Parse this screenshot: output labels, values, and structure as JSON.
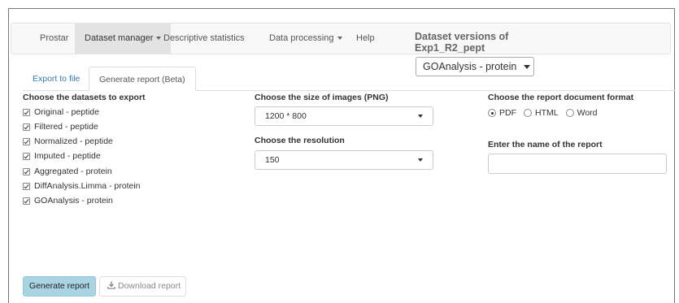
{
  "navbar": {
    "items": [
      {
        "label": "Prostar"
      },
      {
        "label": "Dataset manager"
      },
      {
        "label": "Descriptive statistics"
      },
      {
        "label": "Data processing"
      },
      {
        "label": "Help"
      }
    ]
  },
  "versions": {
    "title_line1": "Dataset versions of",
    "title_line2": "Exp1_R2_pept",
    "selected": "GOAnalysis - protein"
  },
  "tabs": [
    {
      "label": "Export to file"
    },
    {
      "label": "Generate report (Beta)"
    }
  ],
  "datasets": {
    "heading": "Choose the datasets to export",
    "items": [
      {
        "label": "Original - peptide",
        "checked": true
      },
      {
        "label": "Filtered - peptide",
        "checked": true
      },
      {
        "label": "Normalized - peptide",
        "checked": true
      },
      {
        "label": "Imputed - peptide",
        "checked": true
      },
      {
        "label": "Aggregated - protein",
        "checked": true
      },
      {
        "label": "DiffAnalysis.Limma - protein",
        "checked": true
      },
      {
        "label": "GOAnalysis - protein",
        "checked": true
      }
    ]
  },
  "image_size": {
    "heading": "Choose the size of images (PNG)",
    "value": "1200 * 800"
  },
  "resolution": {
    "heading": "Choose the resolution",
    "value": "150"
  },
  "format": {
    "heading": "Choose the report document format",
    "options": [
      "PDF",
      "HTML",
      "Word"
    ],
    "selected": "PDF"
  },
  "report_name": {
    "heading": "Enter the name of the report",
    "value": ""
  },
  "buttons": {
    "generate": "Generate report",
    "download": "Download report"
  },
  "icons": {
    "download": "download-icon",
    "caret": "caret-down-icon"
  }
}
